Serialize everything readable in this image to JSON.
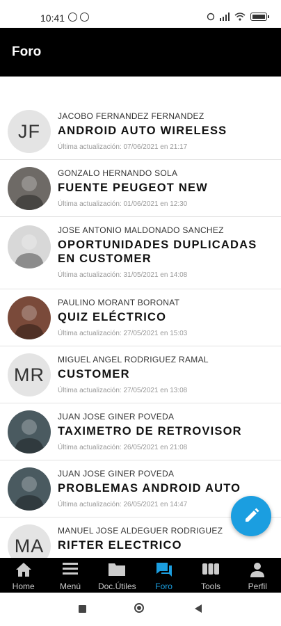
{
  "status_bar": {
    "time": "10:41"
  },
  "appbar": {
    "title": "Foro"
  },
  "topics": [
    {
      "author": "JACOBO FERNANDEZ FERNANDEZ",
      "title": "ANDROID AUTO WIRELESS",
      "updated": "Última actualización: 07/06/2021 en 21:17",
      "initials": "JF",
      "avatar_color": "#e4e4e4"
    },
    {
      "author": "GONZALO HERNANDO SOLA",
      "title": "FUENTE PEUGEOT NEW",
      "updated": "Última actualización: 01/06/2021 en 12:30",
      "initials": "",
      "avatar_color": "#6e6a66"
    },
    {
      "author": "JOSE ANTONIO MALDONADO SANCHEZ",
      "title": "OPORTUNIDADES DUPLICADAS EN CUSTOMER",
      "updated": "Última actualización: 31/05/2021 en 14:08",
      "initials": "",
      "avatar_color": "#d8d8d8"
    },
    {
      "author": "PAULINO MORANT BORONAT",
      "title": "QUIZ ELÉCTRICO",
      "updated": "Última actualización: 27/05/2021 en 15:03",
      "initials": "",
      "avatar_color": "#7a4a3a"
    },
    {
      "author": "MIGUEL ANGEL RODRIGUEZ RAMAL",
      "title": "CUSTOMER",
      "updated": "Última actualización: 27/05/2021 en 13:08",
      "initials": "MR",
      "avatar_color": "#e4e4e4"
    },
    {
      "author": "JUAN JOSE GINER POVEDA",
      "title": "TAXIMETRO DE RETROVISOR",
      "updated": "Última actualización: 26/05/2021 en 21:08",
      "initials": "",
      "avatar_color": "#4a5a60"
    },
    {
      "author": "JUAN JOSE GINER POVEDA",
      "title": "PROBLEMAS ANDROID AUTO",
      "updated": "Última actualización: 26/05/2021 en 14:47",
      "initials": "",
      "avatar_color": "#4a5a60"
    },
    {
      "author": "MANUEL JOSE ALDEGUER RODRIGUEZ",
      "title": "RIFTER ELECTRICO",
      "updated": "",
      "initials": "MA",
      "avatar_color": "#e4e4e4"
    }
  ],
  "bottom_nav": [
    {
      "label": "Home",
      "icon": "home-icon"
    },
    {
      "label": "Menú",
      "icon": "menu-icon"
    },
    {
      "label": "Doc.Útiles",
      "icon": "folder-icon"
    },
    {
      "label": "Foro",
      "icon": "forum-icon",
      "active": true
    },
    {
      "label": "Tools",
      "icon": "tools-icon"
    },
    {
      "label": "Perfil",
      "icon": "person-icon"
    }
  ],
  "colors": {
    "accent": "#1b9ee0",
    "appbar": "#000000",
    "nav_inactive": "#cccccc"
  }
}
